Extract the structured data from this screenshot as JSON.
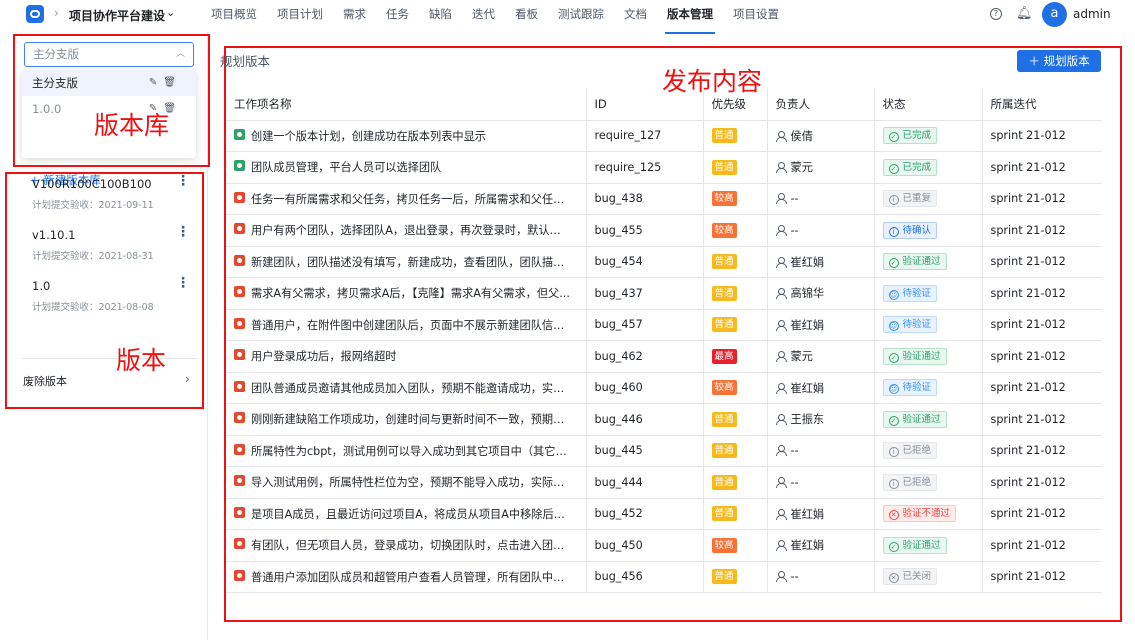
{
  "header": {
    "project_title": "项目协作平台建设",
    "nav": [
      "项目概览",
      "项目计划",
      "需求",
      "任务",
      "缺陷",
      "迭代",
      "看板",
      "测试跟踪",
      "文档",
      "版本管理",
      "项目设置"
    ],
    "active_nav": "版本管理",
    "avatar_letter": "a",
    "username": "admin"
  },
  "branches": {
    "selected_placeholder": "主分支版",
    "options": [
      "主分支版",
      "1.0.0"
    ],
    "new_label": "+ 新建版本库"
  },
  "versions": [
    {
      "name": "V100R100C100B100",
      "sub": "计划提交验收：2021-09-11"
    },
    {
      "name": "v1.10.1",
      "sub": "计划提交验收：2021-08-31"
    },
    {
      "name": "1.0",
      "sub": "计划提交验收：2021-08-08"
    }
  ],
  "deprecated_label": "废除版本",
  "annotations": {
    "lib": "版本库",
    "ver": "版本",
    "content": "发布内容"
  },
  "main": {
    "title": "规划版本",
    "plan_button": "＋ 规划版本",
    "columns": [
      "工作项名称",
      "ID",
      "优先级",
      "负责人",
      "状态",
      "所属迭代"
    ],
    "rows": [
      {
        "type": "req",
        "name": "创建一个版本计划，创建成功在版本列表中显示",
        "id": "require_127",
        "prio": "普通",
        "pclass": "normal",
        "owner": "侯倩",
        "status": "已完成",
        "sclass": "st-done",
        "sico": "✓",
        "sprint": "sprint 21-012"
      },
      {
        "type": "req",
        "name": "团队成员管理，平台人员可以选择团队",
        "id": "require_125",
        "prio": "普通",
        "pclass": "normal",
        "owner": "蒙元",
        "status": "已完成",
        "sclass": "st-done",
        "sico": "✓",
        "sprint": "sprint 21-012"
      },
      {
        "type": "bug",
        "name": "任务一有所属需求和父任务，拷贝任务一后，所属需求和父任务...",
        "id": "bug_438",
        "prio": "较高",
        "pclass": "high",
        "owner": "--",
        "status": "已重复",
        "sclass": "st-dup",
        "sico": "i",
        "sprint": "sprint 21-012"
      },
      {
        "type": "bug",
        "name": "用户有两个团队，选择团队A，退出登录，再次登录时，默认团队...",
        "id": "bug_455",
        "prio": "较高",
        "pclass": "high",
        "owner": "--",
        "status": "待确认",
        "sclass": "st-confirm",
        "sico": "i",
        "sprint": "sprint 21-012"
      },
      {
        "type": "bug",
        "name": "新建团队，团队描述没有填写，新建成功，查看团队，团队描述...",
        "id": "bug_454",
        "prio": "普通",
        "pclass": "normal",
        "owner": "崔红娟",
        "status": "验证通过",
        "sclass": "st-pass",
        "sico": "✓",
        "sprint": "sprint 21-012"
      },
      {
        "type": "bug",
        "name": "需求A有父需求，拷贝需求A后，【克隆】需求A有父需求，但父...",
        "id": "bug_437",
        "prio": "普通",
        "pclass": "normal",
        "owner": "高锦华",
        "status": "待验证",
        "sclass": "st-verify",
        "sico": "☺",
        "sprint": "sprint 21-012"
      },
      {
        "type": "bug",
        "name": "普通用户，在附件图中创建团队后，页面中不展示新建团队信息...",
        "id": "bug_457",
        "prio": "普通",
        "pclass": "normal",
        "owner": "崔红娟",
        "status": "待验证",
        "sclass": "st-verify",
        "sico": "☺",
        "sprint": "sprint 21-012"
      },
      {
        "type": "bug",
        "name": "用户登录成功后，报网络超时",
        "id": "bug_462",
        "prio": "最高",
        "pclass": "highest",
        "owner": "蒙元",
        "status": "验证通过",
        "sclass": "st-pass",
        "sico": "✓",
        "sprint": "sprint 21-012"
      },
      {
        "type": "bug",
        "name": "团队普通成员邀请其他成员加入团队，预期不能邀请成功，实际...",
        "id": "bug_460",
        "prio": "较高",
        "pclass": "high",
        "owner": "崔红娟",
        "status": "待验证",
        "sclass": "st-verify",
        "sico": "☺",
        "sprint": "sprint 21-012"
      },
      {
        "type": "bug",
        "name": "刚刚新建缺陷工作项成功，创建时间与更新时间不一致，预期应...",
        "id": "bug_446",
        "prio": "普通",
        "pclass": "normal",
        "owner": "王振东",
        "status": "验证通过",
        "sclass": "st-pass",
        "sico": "✓",
        "sprint": "sprint 21-012"
      },
      {
        "type": "bug",
        "name": "所属特性为cbpt，测试用例可以导入成功到其它项目中（其它项...",
        "id": "bug_445",
        "prio": "普通",
        "pclass": "normal",
        "owner": "--",
        "status": "已拒绝",
        "sclass": "st-reject",
        "sico": "i",
        "sprint": "sprint 21-012"
      },
      {
        "type": "bug",
        "name": "导入测试用例，所属特性栏位为空，预期不能导入成功，实际可...",
        "id": "bug_444",
        "prio": "普通",
        "pclass": "normal",
        "owner": "--",
        "status": "已拒绝",
        "sclass": "st-reject",
        "sico": "i",
        "sprint": "sprint 21-012"
      },
      {
        "type": "bug",
        "name": "是项目A成员，且最近访问过项目A，将成员从项目A中移除后，...",
        "id": "bug_452",
        "prio": "普通",
        "pclass": "normal",
        "owner": "崔红娟",
        "status": "验证不通过",
        "sclass": "st-fail",
        "sico": "✕",
        "sprint": "sprint 21-012"
      },
      {
        "type": "bug",
        "name": "有团队，但无项目人员，登录成功，切换团队时，点击进入团队...",
        "id": "bug_450",
        "prio": "较高",
        "pclass": "high",
        "owner": "崔红娟",
        "status": "验证通过",
        "sclass": "st-pass",
        "sico": "✓",
        "sprint": "sprint 21-012"
      },
      {
        "type": "bug",
        "name": "普通用户添加团队成员和超管用户查看人员管理，所有团队中没...",
        "id": "bug_456",
        "prio": "普通",
        "pclass": "normal",
        "owner": "--",
        "status": "已关闭",
        "sclass": "st-closed",
        "sico": "✕",
        "sprint": "sprint 21-012"
      }
    ]
  }
}
